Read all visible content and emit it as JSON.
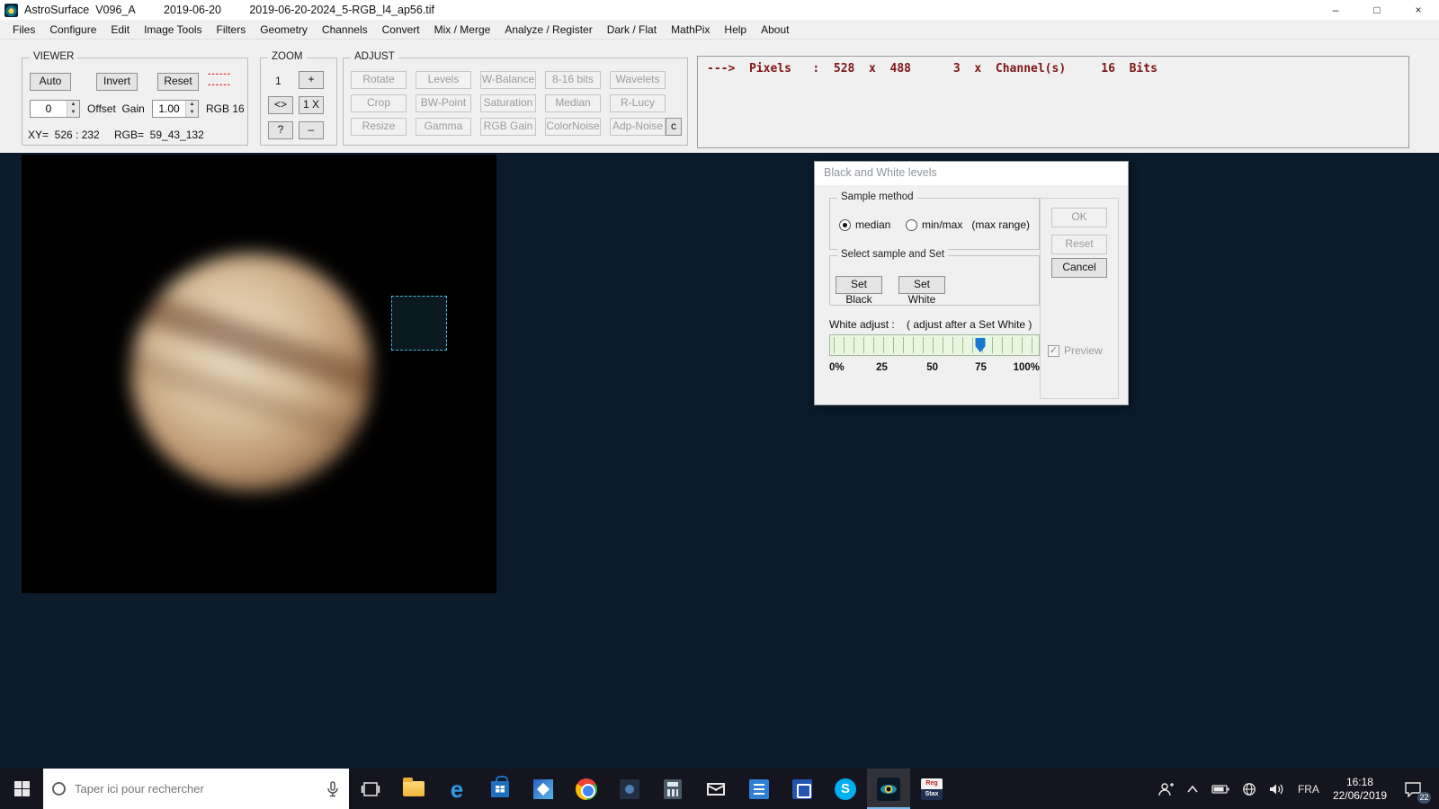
{
  "titlebar": {
    "app": "AstroSurface  V096_A",
    "date": "2019-06-20",
    "file": "2019-06-20-2024_5-RGB_l4_ap56.tif",
    "minimize": "–",
    "maximize": "□",
    "close": "×"
  },
  "menubar": {
    "items": [
      "Files",
      "Configure",
      "Edit",
      "Image Tools",
      "Filters",
      "Geometry",
      "Channels",
      "Convert",
      "Mix / Merge",
      "Analyze / Register",
      "Dark / Flat",
      "MathPix",
      "Help",
      "About"
    ]
  },
  "viewer": {
    "label": "VIEWER",
    "auto": "Auto",
    "invert": "Invert",
    "reset": "Reset",
    "dashes": [
      "------",
      "------"
    ],
    "offset_value": "0",
    "offset_gain_label": "Offset  Gain",
    "gain_value": "1.00",
    "rgb_mode": "RGB 16",
    "xy_readout": "XY=  526 : 232",
    "rgb_readout": "RGB=  59_43_132"
  },
  "zoom": {
    "label": "ZOOM",
    "level": "1",
    "zoom_in": "+",
    "fit": "<>",
    "one_x": "1 X",
    "help": "?",
    "zoom_out": "–"
  },
  "adjust": {
    "label": "ADJUST",
    "buttons": [
      "Rotate",
      "Levels",
      "W-Balance",
      "8-16 bits",
      "Wavelets",
      "Crop",
      "BW-Point",
      "Saturation",
      "Median",
      "R-Lucy",
      "Resize",
      "Gamma",
      "RGB Gain",
      "ColorNoise",
      "Adp-Noise"
    ],
    "c_button": "c"
  },
  "info": {
    "pixels_line": "--->  Pixels   :  528  x  488      3  x  Channel(s)     16  Bits"
  },
  "dialog": {
    "title": "Black and White levels",
    "sample_method": {
      "label": "Sample method",
      "median": "median",
      "minmax": "min/max   (max range)"
    },
    "select_sample": {
      "label": "Select sample and Set",
      "set_black": "Set Black",
      "set_white": "Set White"
    },
    "white_adjust_label": "White adjust :    ( adjust after a Set White )",
    "slider": {
      "value": 72,
      "scale": [
        "0%",
        "25",
        "50",
        "75",
        "100%"
      ]
    },
    "ok": "OK",
    "reset": "Reset",
    "cancel": "Cancel",
    "preview": "Preview"
  },
  "taskbar": {
    "search_placeholder": "Taper ici pour rechercher",
    "icon_glyphs": {
      "edge": "e",
      "skype": "S"
    },
    "registax_top": "Reg",
    "registax_bottom": "Stax",
    "tray": {
      "language": "FRA",
      "time": "16:18",
      "date": "22/06/2019",
      "notification_count": "22"
    }
  },
  "colors": {
    "accent_blue": "#2238c8",
    "info_red": "#7d1616",
    "selection_teal": "#4fb3d9"
  }
}
